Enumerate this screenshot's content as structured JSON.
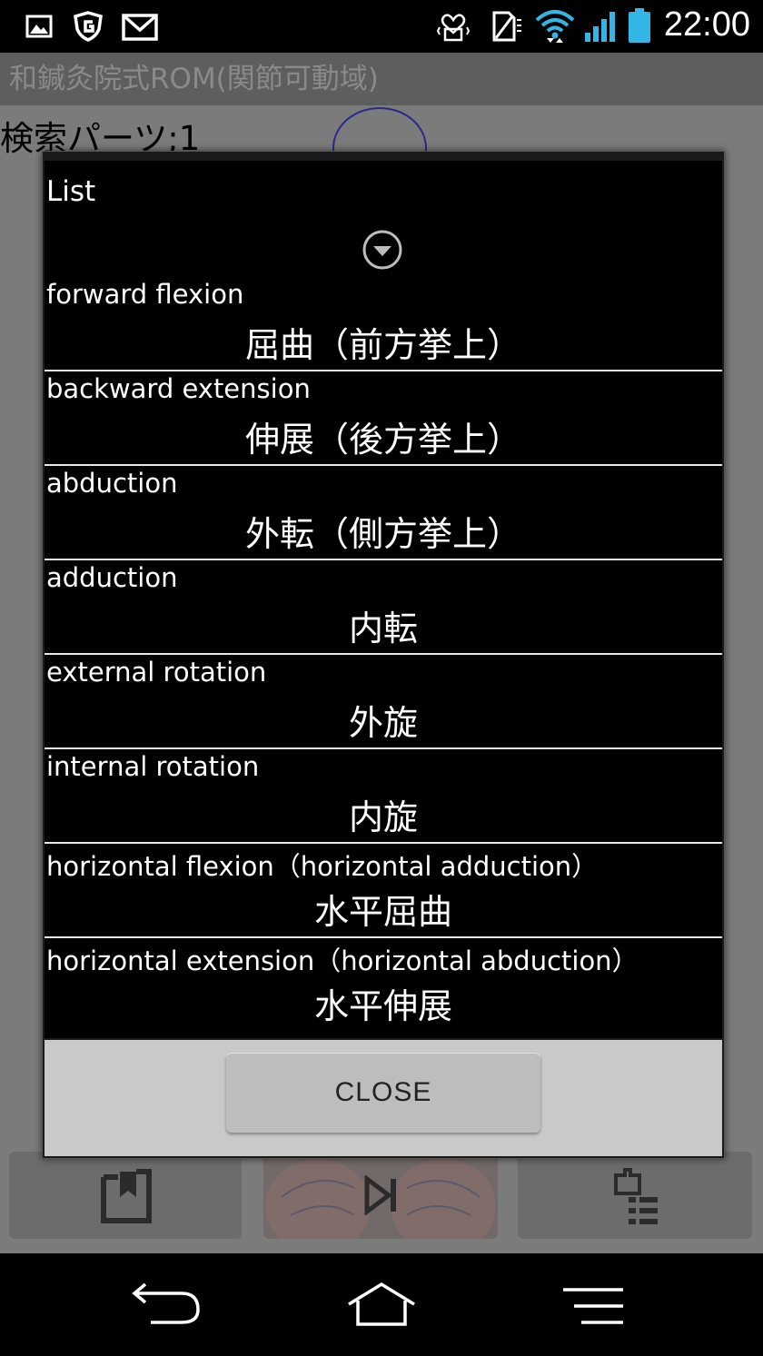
{
  "status_bar": {
    "time": "22:00",
    "icons": [
      "image-icon",
      "shield-icon",
      "gmail-icon",
      "vibrate-icon",
      "no-sim-icon",
      "wifi-icon",
      "signal-icon",
      "battery-icon"
    ]
  },
  "app": {
    "title": "和鍼灸院式ROM(関節可動域)",
    "search_label": "検索パーツ;1"
  },
  "dialog": {
    "title": "List",
    "items": [
      {
        "en": "forward flexion",
        "jp": "屈曲（前方挙上）"
      },
      {
        "en": "backward extension",
        "jp": "伸展（後方挙上）"
      },
      {
        "en": "abduction",
        "jp": "外転（側方挙上）"
      },
      {
        "en": "adduction",
        "jp": "内転"
      },
      {
        "en": "external rotation",
        "jp": "外旋"
      },
      {
        "en": "internal rotation",
        "jp": "内旋"
      },
      {
        "en": "horizontal flexion（horizontal adduction）",
        "jp": "水平屈曲"
      },
      {
        "en": "horizontal extension（horizontal abduction）",
        "jp": "水平伸展"
      }
    ],
    "close_label": "CLOSE"
  },
  "colors": {
    "list_bg": "#000000",
    "footer_bg": "#c9c9c9",
    "accent_wifi": "#33b5e5"
  }
}
